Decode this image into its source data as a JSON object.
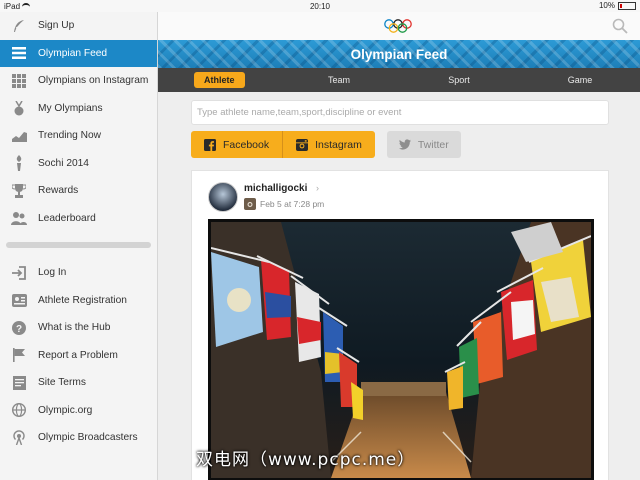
{
  "status": {
    "carrier": "iPad",
    "time": "20:10",
    "battery": "10%"
  },
  "sidebar": {
    "items": [
      {
        "label": "Sign Up",
        "icon": "feather-icon"
      },
      {
        "label": "Olympian Feed",
        "icon": "list-icon",
        "active": true
      },
      {
        "label": "Olympians on Instagram",
        "icon": "grid-icon"
      },
      {
        "label": "My Olympians",
        "icon": "medal-icon"
      },
      {
        "label": "Trending Now",
        "icon": "trend-icon"
      },
      {
        "label": "Sochi 2014",
        "icon": "torch-icon"
      },
      {
        "label": "Rewards",
        "icon": "trophy-icon"
      },
      {
        "label": "Leaderboard",
        "icon": "people-icon"
      }
    ],
    "items2": [
      {
        "label": "Log In",
        "icon": "login-icon"
      },
      {
        "label": "Athlete Registration",
        "icon": "badge-icon"
      },
      {
        "label": "What is the Hub",
        "icon": "question-icon"
      },
      {
        "label": "Report a Problem",
        "icon": "flag-icon"
      },
      {
        "label": "Site Terms",
        "icon": "document-icon"
      },
      {
        "label": "Olympic.org",
        "icon": "globe-icon"
      },
      {
        "label": "Olympic Broadcasters",
        "icon": "broadcast-icon"
      }
    ]
  },
  "header": {
    "title": "Olympian Feed"
  },
  "tabs": [
    "Athlete",
    "Team",
    "Sport",
    "Game"
  ],
  "search": {
    "placeholder": "Type athlete name,team,sport,discipline or event"
  },
  "share": {
    "facebook": "Facebook",
    "instagram": "Instagram",
    "twitter": "Twitter"
  },
  "post": {
    "username": "michalligocki",
    "date": "Feb 5 at 7:28 pm"
  },
  "watermark": "双电网（www.pcpc.me）",
  "colors": {
    "accent": "#1c88c7",
    "tab_active": "#f7a81b",
    "share": "#f7ad1c"
  }
}
